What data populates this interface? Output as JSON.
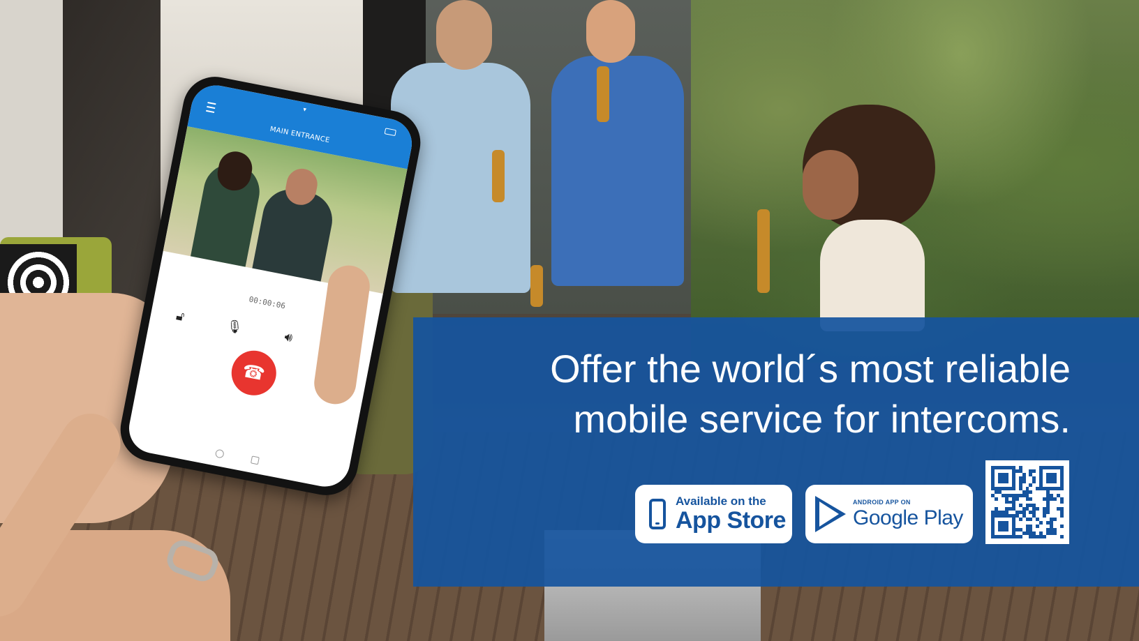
{
  "headline": {
    "line1": "Offer the world´s most reliable",
    "line2": "mobile service for intercoms."
  },
  "badges": {
    "app_store": {
      "small": "Available on the",
      "big": "App Store"
    },
    "google_play": {
      "small": "ANDROID APP ON",
      "big": "Google Play"
    }
  },
  "phone_app": {
    "title": "MAIN ENTRANCE",
    "call_timer": "00:00:06",
    "controls": [
      "unlock-icon",
      "microphone-icon",
      "speaker-icon",
      "camera-icon"
    ],
    "hangup_icon": "hang-up-icon"
  },
  "colors": {
    "panel_blue": "#16549e",
    "app_bar_blue": "#1a7fd6",
    "hangup_red": "#e8352f",
    "text_white": "#ffffff"
  }
}
